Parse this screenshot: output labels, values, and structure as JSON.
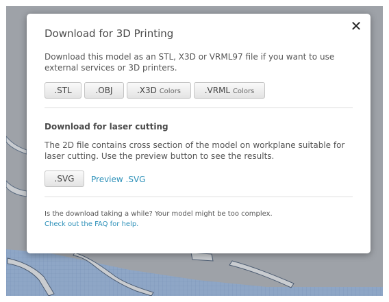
{
  "modal": {
    "close_symbol": "✕",
    "title": "Download for 3D Printing",
    "description": "Download this model as an STL, X3D or VRML97 file if you want to use external services or 3D printers.",
    "buttons_3d": [
      {
        "label": ".STL",
        "sub": ""
      },
      {
        "label": ".OBJ",
        "sub": ""
      },
      {
        "label": ".X3D",
        "sub": "Colors"
      },
      {
        "label": ".VRML",
        "sub": "Colors"
      }
    ],
    "laser": {
      "title": "Download for laser cutting",
      "description": "The 2D file contains cross section of the model on workplane suitable for laser cutting. Use the preview button to see the results.",
      "svg_button": ".SVG",
      "preview_link": "Preview .SVG"
    },
    "footer": {
      "note": "Is the download taking a while? Your model might be too complex.",
      "faq_link": "Check out the FAQ for help."
    }
  },
  "colors": {
    "link": "#2a8fb8",
    "backdrop": "#9ea2a8",
    "grid": "#6f8fb4"
  }
}
